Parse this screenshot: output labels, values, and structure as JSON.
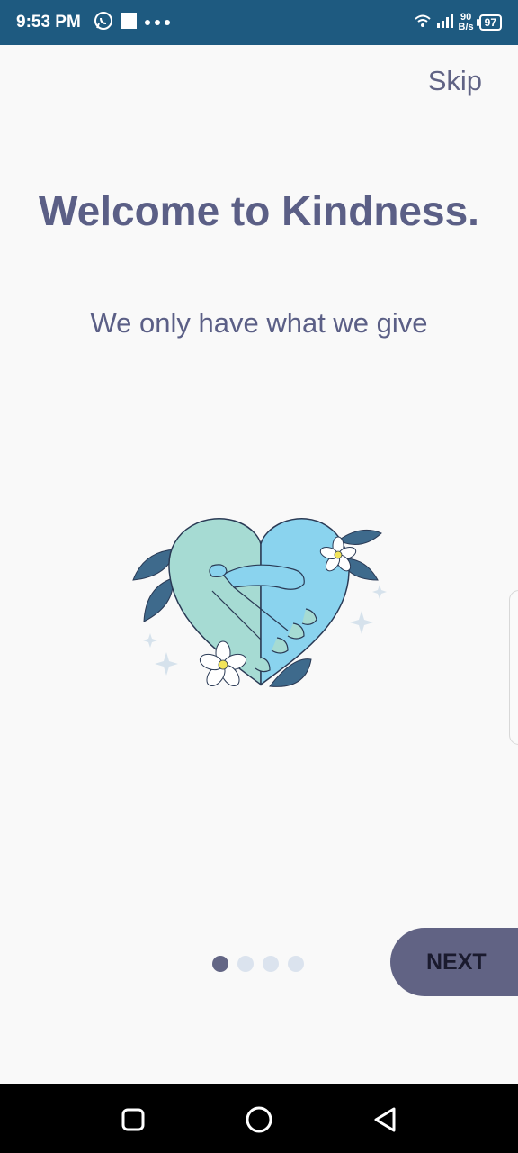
{
  "status_bar": {
    "time": "9:53 PM",
    "net_speed_value": "90",
    "net_speed_unit": "B/s",
    "battery": "97",
    "icons": [
      "whatsapp-icon",
      "square-notification-icon",
      "more-dots-icon",
      "wifi-icon",
      "signal-icon",
      "battery-icon"
    ]
  },
  "onboarding": {
    "skip_label": "Skip",
    "title": "Welcome to Kindness.",
    "subtitle": "We only have what we give",
    "illustration": "heart-handshake-illustration",
    "pager": {
      "total": 4,
      "active": 1
    },
    "next_label": "NEXT"
  },
  "nav_bar": {
    "icons": [
      "recents-icon",
      "home-icon",
      "back-icon"
    ]
  },
  "colors": {
    "status_bar": "#1e5a80",
    "accent": "#616384",
    "text": "#5b5f86",
    "dot_inactive": "#dbe3ee"
  }
}
